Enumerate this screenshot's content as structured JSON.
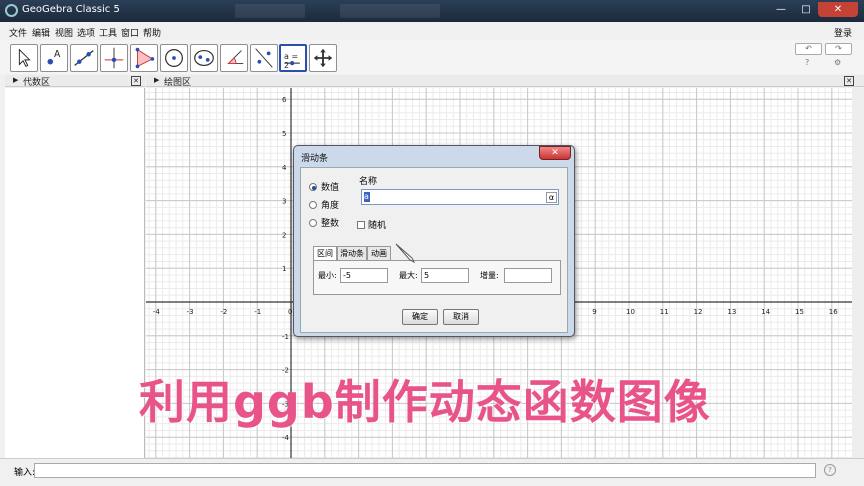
{
  "window": {
    "title": "GeoGebra Classic 5",
    "minimize": "—",
    "maximize": "□",
    "close": "✕"
  },
  "menu": {
    "items": [
      "文件",
      "编辑",
      "视图",
      "选项",
      "工具",
      "窗口",
      "帮助"
    ],
    "login": "登录"
  },
  "toolbar": {
    "tools": [
      "move-tool",
      "point-tool",
      "line-tool",
      "perpendicular-tool",
      "polygon-tool",
      "circle-tool",
      "ellipse-tool",
      "angle-tool",
      "reflect-tool",
      "slider-tool",
      "move-graphics-tool"
    ],
    "selected": "slider-tool",
    "slider_tool_label": "a = 2",
    "undo": "↶",
    "redo": "↷",
    "help_icon": "?",
    "settings_icon": "⚙"
  },
  "panels": {
    "algebra": {
      "title": "代数区",
      "close": "✕"
    },
    "graphics": {
      "title": "绘图区",
      "close": "✕"
    }
  },
  "axes": {
    "x_ticks": [
      -4,
      -3,
      -2,
      -1,
      0,
      9,
      10,
      11,
      12,
      13,
      14,
      15,
      16
    ],
    "y_ticks": [
      6,
      5,
      4,
      3,
      2,
      1,
      -1,
      -2,
      -3,
      -4
    ]
  },
  "dialog": {
    "title": "滑动条",
    "close": "✕",
    "types": [
      "数值",
      "角度",
      "整数"
    ],
    "selected_type": "数值",
    "name_label": "名称",
    "name_value": "a",
    "alpha_button": "α",
    "random_label": "随机",
    "tabs": [
      "区间",
      "滑动条",
      "动画"
    ],
    "active_tab": "区间",
    "min_label": "最小:",
    "min_value": "-5",
    "max_label": "最大:",
    "max_value": "5",
    "step_label": "增量:",
    "step_value": "",
    "ok": "确定",
    "cancel": "取消"
  },
  "input_bar": {
    "label": "输入:",
    "value": "",
    "help": "?"
  },
  "overlay_caption": "利用ggb制作动态函数图像",
  "colors": {
    "caption": "#e8548a",
    "titlebar": "#1c2a3c",
    "dialog_border": "#cbd9ea",
    "selected_tool": "#2a4fb0"
  }
}
